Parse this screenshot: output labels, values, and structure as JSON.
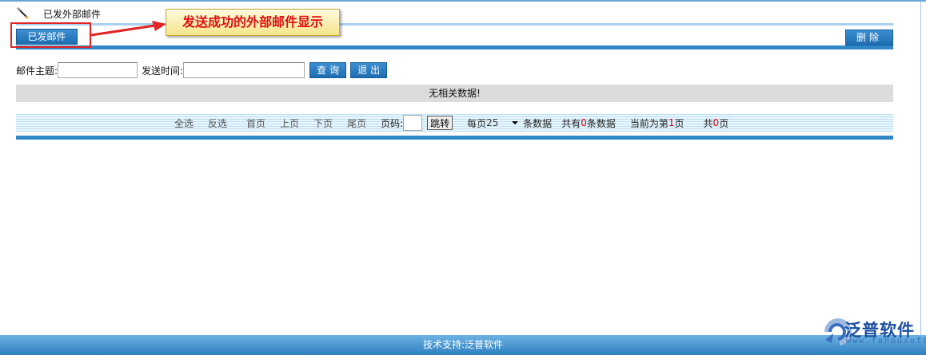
{
  "page": {
    "title": "已发外部邮件"
  },
  "toolbar": {
    "tab_label": "已发邮件",
    "delete_label": "删除"
  },
  "search": {
    "subject_label": "邮件主题:",
    "subject_value": "",
    "time_label": "发送时间:",
    "time_value": "",
    "query_label": "查询",
    "exit_label": "退出"
  },
  "table": {
    "empty_message": "无相关数据!"
  },
  "pager": {
    "select_all": "全选",
    "invert": "反选",
    "first": "首页",
    "prev": "上页",
    "next": "下页",
    "last": "尾页",
    "page_label": "页码:",
    "page_value": "",
    "jump_label": "跳转",
    "per_page_prefix": "每页",
    "per_page_value": "25",
    "per_page_suffix": "条数据",
    "total_prefix": "共有",
    "total_count": "0",
    "total_suffix": "条数据",
    "current_prefix": "当前为第",
    "current_page": "1",
    "current_suffix": "页",
    "pages_prefix": "共",
    "pages_count": "0",
    "pages_suffix": "页"
  },
  "footer": {
    "text": "技术支持:泛普软件"
  },
  "logo": {
    "name": "泛普软件",
    "url_text": "www.fanpusoft.com"
  },
  "annotation": {
    "callout_text": "发送成功的外部邮件显示"
  },
  "colors": {
    "accent": "#2f87c5",
    "callout_text": "#e0100f",
    "highlight_box": "#e32424"
  }
}
